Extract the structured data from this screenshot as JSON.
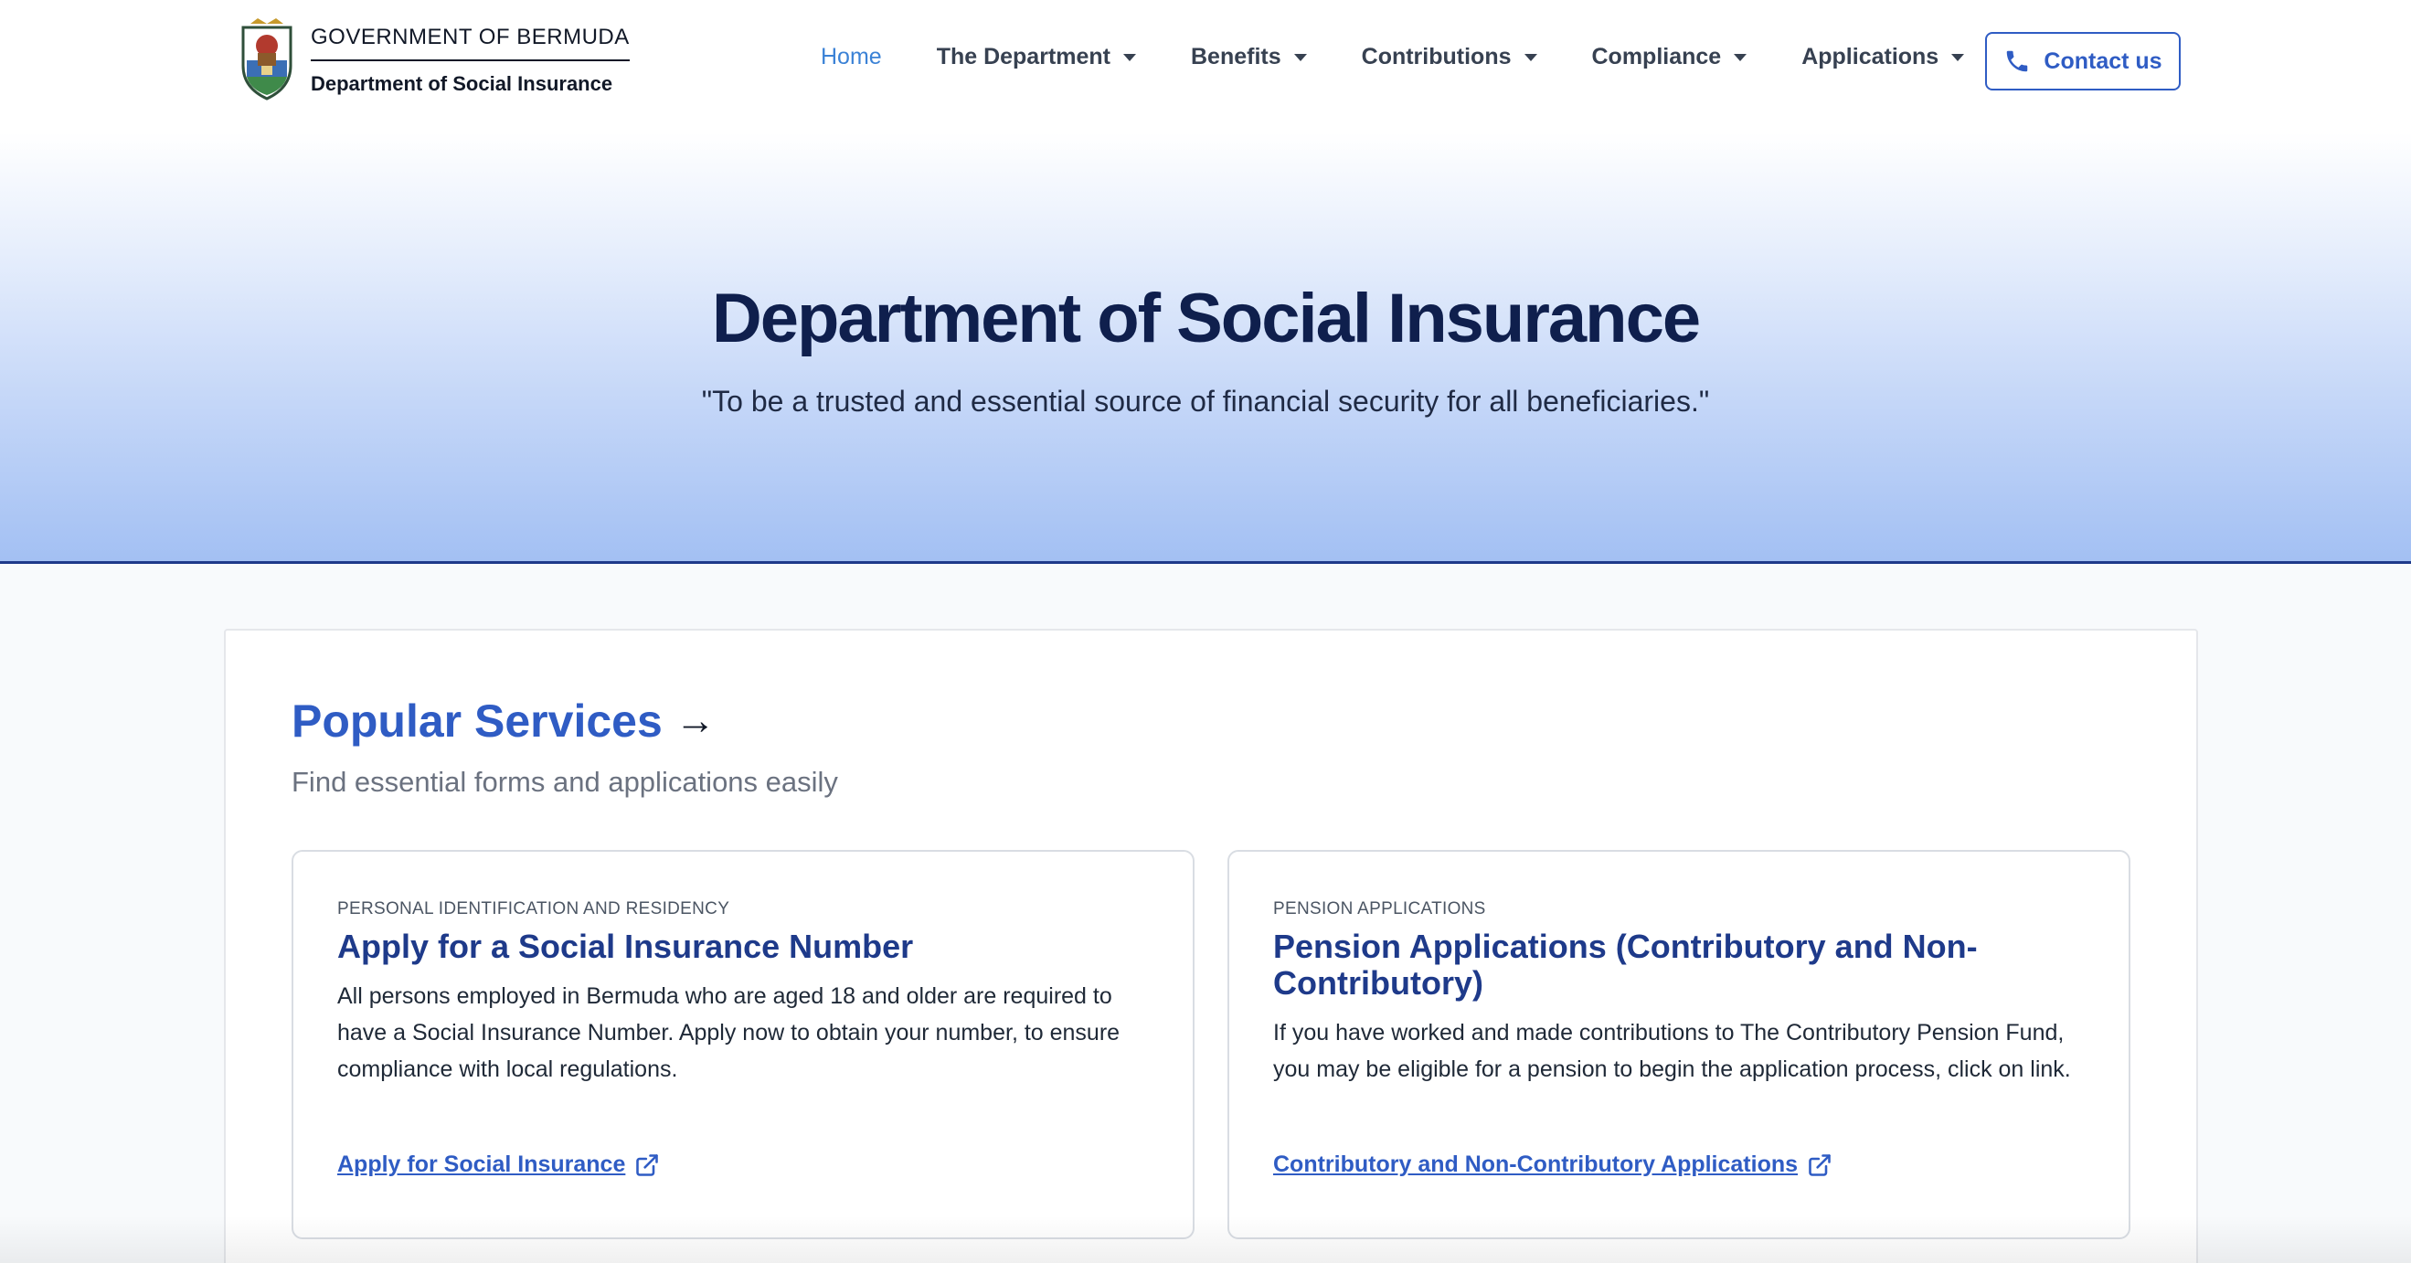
{
  "header": {
    "brand": {
      "government": "GOVERNMENT OF BERMUDA",
      "department": "Department of Social Insurance"
    },
    "nav": [
      {
        "label": "Home",
        "active": true,
        "dropdown": false
      },
      {
        "label": "The Department",
        "active": false,
        "dropdown": true
      },
      {
        "label": "Benefits",
        "active": false,
        "dropdown": true
      },
      {
        "label": "Contributions",
        "active": false,
        "dropdown": true
      },
      {
        "label": "Compliance",
        "active": false,
        "dropdown": true
      },
      {
        "label": "Applications",
        "active": false,
        "dropdown": true
      }
    ],
    "contact_label": "Contact us",
    "contact_icon": "phone-icon"
  },
  "hero": {
    "title": "Department of Social Insurance",
    "tagline": "\"To be a trusted and essential source of financial security for all beneficiaries.\""
  },
  "services": {
    "title": "Popular Services",
    "arrow": "→",
    "subtitle": "Find essential forms and applications easily",
    "cards": [
      {
        "eyebrow": "PERSONAL IDENTIFICATION AND RESIDENCY",
        "title": "Apply for a Social Insurance Number",
        "body": "All persons employed in Bermuda who are aged 18 and older are required to have a Social Insurance Number. Apply now to obtain your number, to ensure compliance with local regulations.",
        "link": "Apply for Social Insurance",
        "link_icon": "external-link-icon"
      },
      {
        "eyebrow": "PENSION APPLICATIONS",
        "title": "Pension Applications (Contributory and Non-Contributory)",
        "body": "If you have worked and made contributions to The Contributory Pension Fund, you may be eligible for a pension to begin the application process, click on link.",
        "link": "Contributory and Non-Contributory Applications",
        "link_icon": "external-link-icon"
      }
    ]
  },
  "colors": {
    "accent": "#2f5cc4",
    "nav_active": "#3b82d6",
    "hero_title": "#0f1f4d",
    "card_title": "#1e3a8a"
  }
}
